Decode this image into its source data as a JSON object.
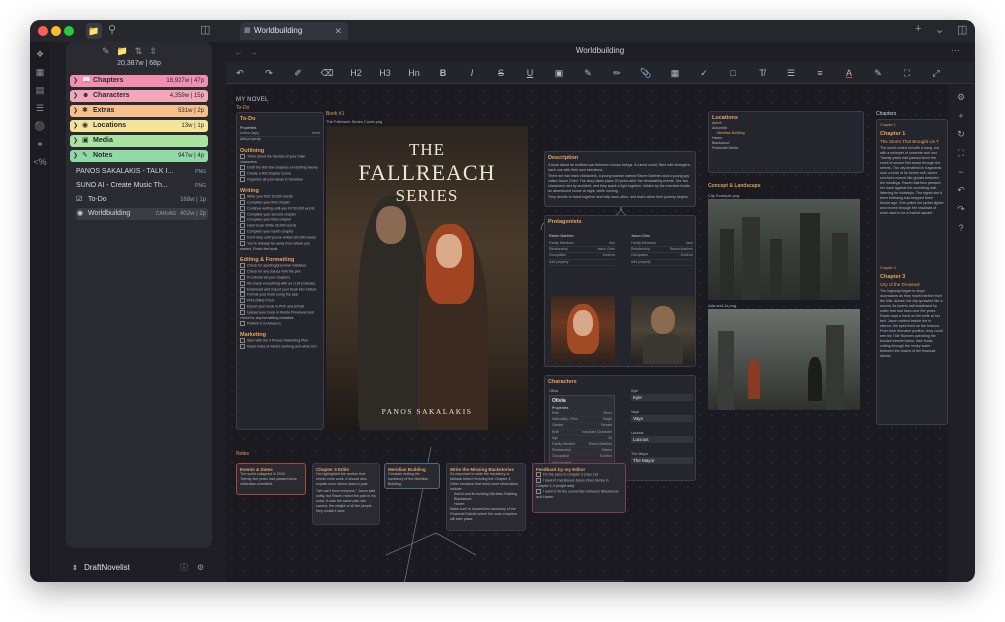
{
  "window": {
    "tab_title": "Worldbuilding",
    "main_title": "Worldbuilding"
  },
  "sidebar": {
    "stats": "20,387w | 68p",
    "folders": [
      {
        "label": "Chapters",
        "meta": "18,927w | 47p",
        "color": "#f28fb1",
        "icon": "book-icon"
      },
      {
        "label": "Characters",
        "meta": "4,359w | 15p",
        "color": "#f4a7b9",
        "icon": "people-icon"
      },
      {
        "label": "Extras",
        "meta": "531w | 2p",
        "color": "#f7bf8a",
        "icon": "star-icon"
      },
      {
        "label": "Locations",
        "meta": "13w | 1p",
        "color": "#f6e39a",
        "icon": "pin-icon"
      },
      {
        "label": "Media",
        "meta": "",
        "color": "#a9e3a0",
        "icon": "image-icon"
      },
      {
        "label": "Notes",
        "meta": "947w | 4p",
        "color": "#93d9a7",
        "icon": "note-icon"
      }
    ],
    "files": [
      {
        "label": "PANOS SAKALAKIS - TALK I...",
        "tag": "PNG",
        "meta": ""
      },
      {
        "label": "SUNO AI - Create Music Th...",
        "tag": "PNG",
        "meta": ""
      },
      {
        "label": "To-Do",
        "tag": "",
        "meta": "168w | 1p"
      },
      {
        "label": "Worldbuilding",
        "tag": "CANVAS",
        "meta": "402w | 2p"
      }
    ],
    "vault_name": "DraftNovelist"
  },
  "toolbar": {
    "buttons": [
      "undo-icon",
      "redo-icon",
      "brush-icon",
      "eraser-icon",
      "H2",
      "H3",
      "Hn",
      "B",
      "I",
      "S",
      "U",
      "cube-icon",
      "highlight-icon",
      "edit-icon",
      "attach-icon",
      "table-icon",
      "check-icon",
      "comment-icon",
      "clear-format-icon",
      "list-icon",
      "align-icon",
      "A",
      "marker-icon",
      "expand-icon",
      "collapse-icon"
    ]
  },
  "canvas": {
    "group_title": "MY NOVEL",
    "todo": {
      "label": "To-Do",
      "title": "To-Do",
      "properties_label": "Properties",
      "property_key": "author (tags)",
      "property_val": "trend",
      "property_add": "Add property",
      "sections": [
        {
          "title": "Outlining",
          "items": [
            "Think about the themes of your main characters",
            "Draft the first few chapters everything twenty",
            "Create a first chapter scene",
            "Organize all your ideas in Obsidian"
          ]
        },
        {
          "title": "Writing",
          "items": [
            "Write your first 10,000 words",
            "Complete your first chapter",
            "Continue writing until you hit 50,000 words",
            "Complete your second chapter",
            "Complete your third chapter",
            "Hard Goal: Write 30,000 words",
            "Complete your fourth chapter",
            "Don't stop until you've written 80,000 words",
            "You're already far away from where you started. Finish the book."
          ]
        },
        {
          "title": "Editing & Formatting",
          "items": [
            "Check for spelling/grammar mistakes",
            "Check for any issues with the plot",
            "Proofread all your chapters",
            "Re-check everything with an LLM (Claude)",
            "Download and import your book into Vellum",
            "Format your book using the app",
            "Print (Mini) Proof",
            "Export your book in PDF and EPUB",
            "Upload your book in Kindle Previewer and check for any formatting mistakes",
            "Publish it on Amazon"
          ]
        },
        {
          "title": "Marketing",
          "items": [
            "Start with the 4 Proven Marketing Plan",
            "Read notes of what's working and what isn't"
          ]
        }
      ]
    },
    "book": {
      "label": "Book #1",
      "cover_file": "The Fallreach Series Cover.png",
      "cover_title_1": "THE",
      "cover_title_2": "FALLREACH",
      "cover_title_3": "SERIES",
      "author": "PANOS SAKALAKIS"
    },
    "description": {
      "title": "Description",
      "paragraphs": [
        "A book about an endless war between human beings. A ruined world, filled with strangers, each one with their own intentions.",
        "There are two main characters, a young woman named Raven Marthen and a young guy called Jason Chen. The story takes place 20 years after the devastating events. Our two characters met by accident, and they spark a light together, hidden by the enemies inside an abandoned house at night, while running.",
        "They decide to travel together and help each other, and that's when their journey begins."
      ]
    },
    "protagonists": {
      "label": "Protagonists",
      "raven": {
        "name": "Raven Marthen",
        "rows": [
          [
            "Family Members",
            "Ash"
          ],
          [
            "Relationship",
            "Jason Chen"
          ],
          [
            "Occupation",
            "Survivor"
          ],
          [
            "Add property",
            ""
          ]
        ]
      },
      "jason": {
        "name": "Jason Chen",
        "rows": [
          [
            "Family Members",
            "Jane"
          ],
          [
            "Relationship",
            "Raven Marthen"
          ],
          [
            "Occupation",
            "Survivor"
          ],
          [
            "Add property",
            ""
          ]
        ]
      }
    },
    "characters": {
      "label": "Characters",
      "olivia": {
        "name": "Olivia",
        "title": "Olivia",
        "rows": [
          [
            "Role",
            "Minor"
          ],
          [
            "Nationality / Ethn.",
            "Single"
          ],
          [
            "Gender",
            "Female"
          ],
          [
            "Role",
            "Important Character"
          ],
          [
            "Age",
            "26"
          ],
          [
            "Family Member",
            "Raven Marthen"
          ],
          [
            "Relationship",
            "Sisters"
          ],
          [
            "Occupation",
            "Survivor"
          ],
          [
            "Add property",
            ""
          ]
        ]
      },
      "others": [
        {
          "label": "Kyle",
          "value": "Kyle"
        },
        {
          "label": "Vaya",
          "value": "Vaya"
        },
        {
          "label": "Lucious",
          "value": "Lucious"
        },
        {
          "label": "The Mayor",
          "value": "The Mayor"
        }
      ]
    },
    "locations": {
      "label": "Locations",
      "items": [
        "Ashvil",
        "Autumfall",
        "Meridian Building",
        "Haven",
        "Blackwood",
        "Financial District"
      ]
    },
    "concept": {
      "label": "Concept & Landscape",
      "img1": "City Example.png",
      "img2": "Aria and Jo.png"
    },
    "chapters": {
      "label": "Chapters",
      "ch1_label": "Chapter 1",
      "ch1_title": "Chapter 1",
      "ch1_heading": "The Storm That Brought Us T",
      "ch1_text": "The world ended not with a bang, but with a whimper of concrete and rust. Twenty years had passed since the smell of smoke first swept through the streets. The city breathed in fragments now, a husk of its former self, where survivors moved like ghosts between the buildings. Raven Marthen pressed her back against the crumbling wall, listening for footsteps. The signal she'd been following had stopped three blocks ago. She pulled her jacket tighter and moved through the shadows of what used to be a market square.",
      "ch3_label": "Chapter 3",
      "ch3_title": "Chapter 3",
      "ch3_heading": "City of the Drowned",
      "ch3_text": "The highway began to slope downwards as they moved farther from the hills. Ahead, the city sprawled like a wound, its towers half swallowed by water that had risen over the years. Raven kept a hand on the knife at her belt. Jason walked beside her in silence, his eyes fixed on the horizon. From their elevated position, they could see the Tide Runners patrolling the flooded streets below, their boats cutting through the murky water between the towers of the financial district."
    },
    "notes": {
      "label": "Notes",
      "cards": [
        {
          "title": "Events & Dates",
          "lines": [
            "The world collapsed in 2040.",
            "Twenty-five years had passed since civilization crumbled."
          ]
        },
        {
          "title": "Chapter 3 Edits",
          "lines": [
            "I've highlighted the section that needs more work. It should also explain more about Jason's past.",
            "\"We can't trust everyone,\" Jason said softly, but Raven heard the pain in his voice. It was the same pain she carried, the weight of all the people they couldn't save."
          ]
        },
        {
          "title": "Meridian Building",
          "lines": [
            "Consider writing the backstory of the Meridian Building."
          ]
        },
        {
          "title": "Write the Missing Backstories",
          "lines": [
            "It's important to write the backstory or fallback before finishing the Chapter 4.",
            "Other locations that need more information include:",
            "Ashvil and its building Meridian Building",
            "Blackwood",
            "Haven",
            "Make sure to expand the backstory of the Financial District where the main chapters will take place."
          ]
        },
        {
          "title": "Feedback by my Editor",
          "lines": [
            "Fix the pace in Chapter 3 (See 10)",
            "I haven't mentioned Jason Chen family in Chapter 1-3 (might add)",
            "I want to fix the connection between Blackwood and Haven"
          ]
        }
      ]
    }
  },
  "colors": {
    "accent": "#e8a45e",
    "background": "#1a1a20",
    "card": "#25252d"
  }
}
